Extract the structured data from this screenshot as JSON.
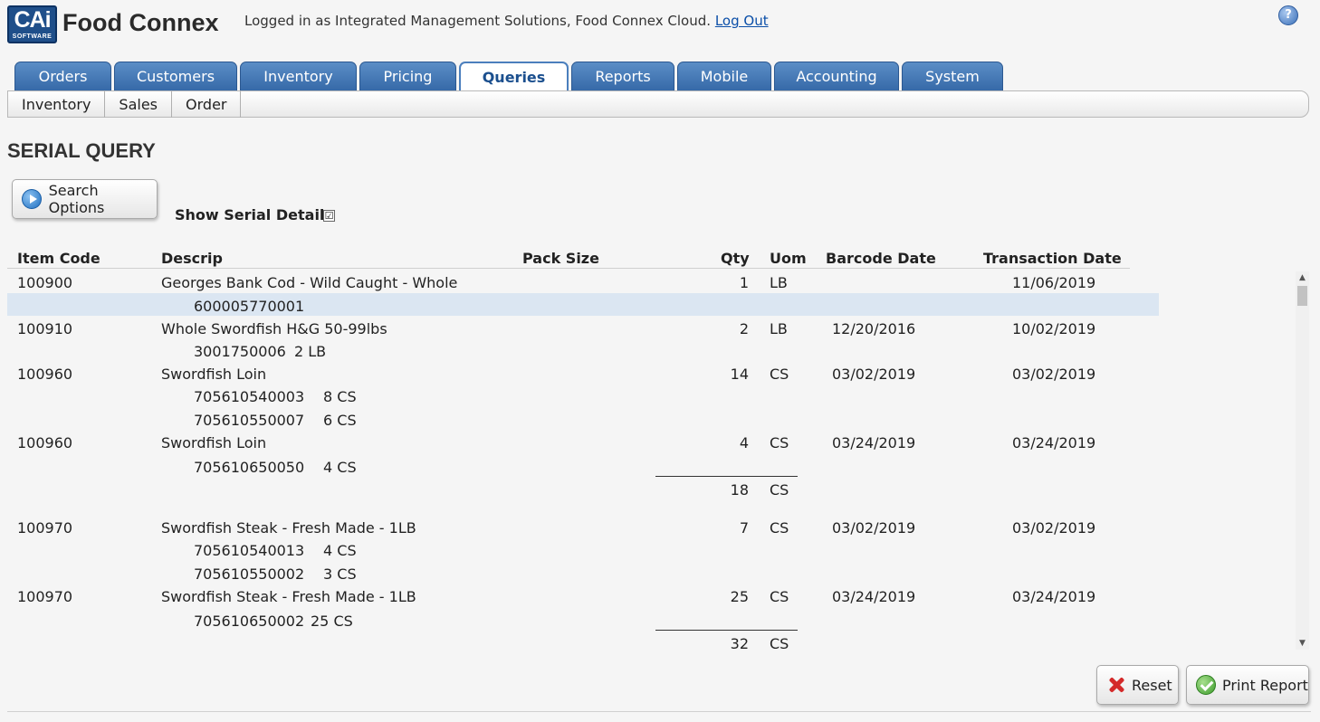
{
  "header": {
    "logo_main": "CAi",
    "logo_sub": "SOFTWARE",
    "product": "Food Connex",
    "login_text": "Logged in as Integrated Management Solutions, Food Connex Cloud.",
    "logout": "Log Out",
    "help_glyph": "?"
  },
  "tabs": [
    "Orders",
    "Customers",
    "Inventory",
    "Pricing",
    "Queries",
    "Reports",
    "Mobile",
    "Accounting",
    "System"
  ],
  "active_tab": "Queries",
  "subtabs": [
    "Inventory",
    "Sales",
    "Order"
  ],
  "page": {
    "title": "SERIAL QUERY",
    "search_button": "Search Options",
    "show_serial_detail_label": "Show Serial Detail",
    "show_serial_detail_checked": true,
    "checkbox_glyph": "☑"
  },
  "columns": {
    "item_code": "Item Code",
    "descrip": "Descrip",
    "pack_size": "Pack Size",
    "qty": "Qty",
    "uom": "Uom",
    "barcode_date": "Barcode Date",
    "transaction_date": "Transaction Date"
  },
  "rows": [
    {
      "item_code": "100900",
      "descrip": "Georges Bank Cod - Wild Caught - Whole",
      "qty": "1",
      "uom": "LB",
      "barcode_date": "",
      "transaction_date": "11/06/2019",
      "serials": [
        {
          "serial": "600005770001",
          "amount": ""
        }
      ]
    },
    {
      "item_code": "100910",
      "descrip": "Whole Swordfish H&G 50-99lbs",
      "qty": "2",
      "uom": "LB",
      "barcode_date": "12/20/2016",
      "transaction_date": "10/02/2019",
      "serials": [
        {
          "serial": "3001750006",
          "amount": "2 LB"
        }
      ]
    },
    {
      "item_code": "100960",
      "descrip": "Swordfish Loin",
      "qty": "14",
      "uom": "CS",
      "barcode_date": "03/02/2019",
      "transaction_date": "03/02/2019",
      "serials": [
        {
          "serial": "705610540003",
          "amount": "8 CS"
        },
        {
          "serial": "705610550007",
          "amount": "6 CS"
        }
      ]
    },
    {
      "item_code": "100960",
      "descrip": "Swordfish Loin",
      "qty": "4",
      "uom": "CS",
      "barcode_date": "03/24/2019",
      "transaction_date": "03/24/2019",
      "serials": [
        {
          "serial": "705610650050",
          "amount": "4 CS"
        }
      ]
    },
    {
      "item_code": "100970",
      "descrip": "Swordfish Steak - Fresh Made - 1LB",
      "qty": "7",
      "uom": "CS",
      "barcode_date": "03/02/2019",
      "transaction_date": "03/02/2019",
      "serials": [
        {
          "serial": "705610540013",
          "amount": "4 CS"
        },
        {
          "serial": "705610550002",
          "amount": "3 CS"
        }
      ]
    },
    {
      "item_code": "100970",
      "descrip": "Swordfish Steak - Fresh Made - 1LB",
      "qty": "25",
      "uom": "CS",
      "barcode_date": "03/24/2019",
      "transaction_date": "03/24/2019",
      "serials": [
        {
          "serial": "705610650002",
          "amount": "25 CS"
        }
      ]
    }
  ],
  "subtotals": [
    {
      "qty": "18",
      "uom": "CS"
    },
    {
      "qty": "32",
      "uom": "CS"
    }
  ],
  "footer": {
    "reset": "Reset",
    "print": "Print Report"
  },
  "colors": {
    "tab_blue": "#3669a8",
    "active_tab_text": "#1b4f8e",
    "row_highlight": "#dbe6f2",
    "link": "#0b4fa8"
  }
}
